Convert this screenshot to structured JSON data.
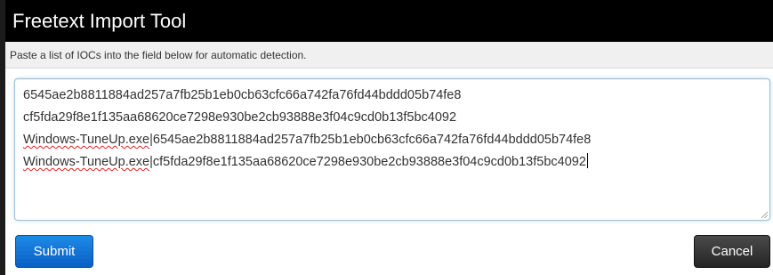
{
  "dialog": {
    "title": "Freetext Import Tool",
    "instruction": "Paste a list of IOCs into the field below for automatic detection."
  },
  "textarea": {
    "lines": [
      {
        "text": "6545ae2b8811884ad257a7fb25b1eb0cb63cfc66a742fa76fd44bddd05b74fe8"
      },
      {
        "text": "cf5fda29f8e1f135aa68620ce7298e930be2cb93888e3f04c9cd0b13f5bc4092"
      },
      {
        "name": "Windows-TuneUp.exe",
        "sep": "|",
        "hash": "6545ae2b8811884ad257a7fb25b1eb0cb63cfc66a742fa76fd44bddd05b74fe8"
      },
      {
        "name": "Windows-TuneUp.exe",
        "sep": "|",
        "hash": "cf5fda29f8e1f135aa68620ce7298e930be2cb93888e3f04c9cd0b13f5bc4092"
      }
    ]
  },
  "buttons": {
    "submit_label": "Submit",
    "cancel_label": "Cancel"
  },
  "colors": {
    "title_bar": "#000000",
    "submit": "#0a6fd6",
    "cancel": "#333333"
  }
}
